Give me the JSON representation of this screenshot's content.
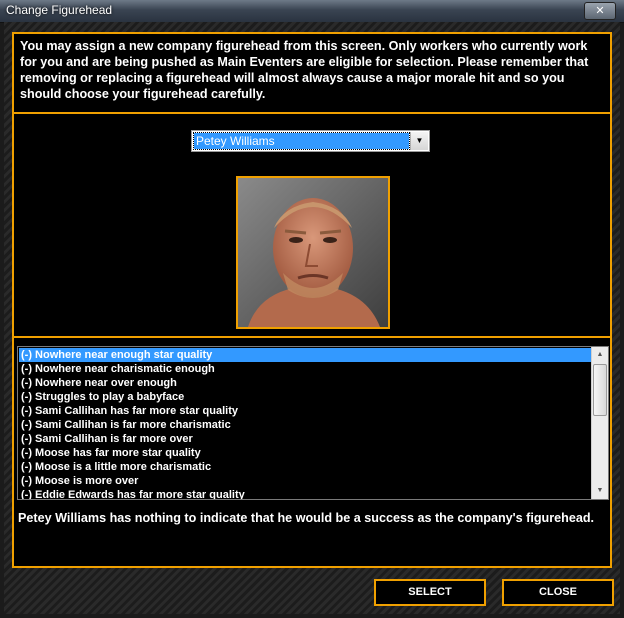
{
  "window": {
    "title": "Change Figurehead",
    "close_glyph": "✕"
  },
  "intro_text": "You may assign a new company figurehead from this screen. Only workers who currently work for you and are being pushed as Main Eventers are eligible for selection. Please remember that removing or replacing a figurehead will almost always cause a major morale hit and so you should choose your figurehead carefully.",
  "worker_select": {
    "selected": "Petey Williams",
    "arrow_icon": "chevron-down-icon"
  },
  "reasons": [
    "(-) Nowhere near enough star quality",
    "(-) Nowhere near charismatic enough",
    "(-) Nowhere near over enough",
    "(-) Struggles to play a babyface",
    "(-) Sami Callihan has far more star quality",
    "(-) Sami Callihan is far more charismatic",
    "(-) Sami Callihan is far more over",
    "(-) Moose has far more star quality",
    "(-) Moose is a little more charismatic",
    "(-) Moose is more over",
    "(-) Eddie Edwards has far more star quality"
  ],
  "summary_text": "Petey Williams has nothing to indicate that he would be a success as the company's figurehead.",
  "buttons": {
    "select": "SELECT",
    "close": "CLOSE"
  },
  "colors": {
    "accent": "#f0a000",
    "selection": "#3399ff",
    "panel": "#000000"
  }
}
